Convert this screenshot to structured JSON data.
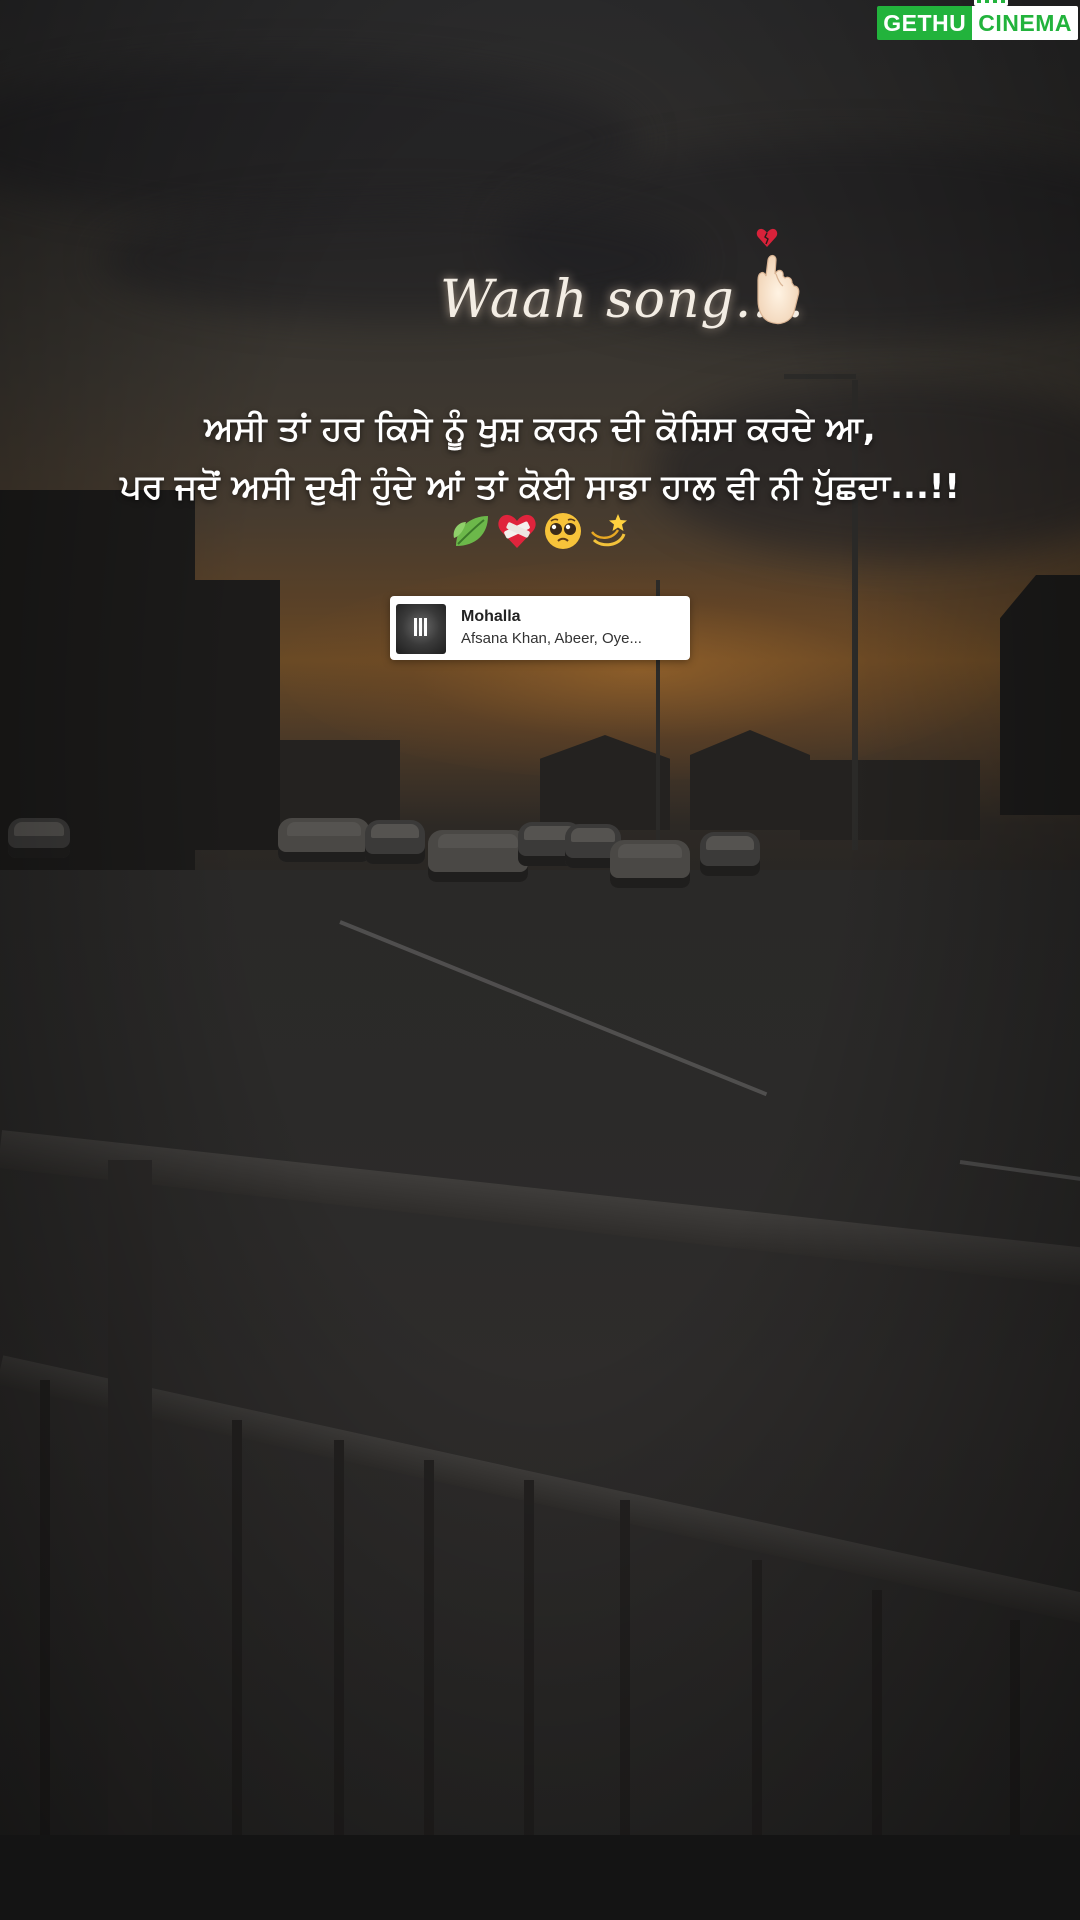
{
  "watermark": {
    "left_text": "GETHU",
    "right_text": "CINEMA",
    "accent": "#22b33c"
  },
  "header": {
    "script_text": "Waah song....",
    "icons": [
      "broken-heart-icon",
      "finger-heart-hand-icon"
    ]
  },
  "quote": {
    "line1": "ਅਸੀ ਤਾਂ ਹਰ ਕਿਸੇ ਨੂੰ ਖੁਸ਼ ਕਰਨ ਦੀ ਕੋਸ਼ਿਸ ਕਰਦੇ ਆ,",
    "line2": "ਪਰ ਜਦੋਂ ਅਸੀ ਦੁਖੀ ਹੁੰਦੇ ਆਂ ਤਾਂ ਕੋਈ ਸਾਡਾ ਹਾਲ ਵੀ ਨੀ ਪੁੱਛਦਾ...!!",
    "emojis": [
      "leaf-icon",
      "bandaged-heart-icon",
      "pleading-face-icon",
      "dizzy-star-icon"
    ]
  },
  "music": {
    "title": "Mohalla",
    "artist": "Afsana Khan, Abeer, Oye...",
    "state_icon": "pause-icon"
  }
}
